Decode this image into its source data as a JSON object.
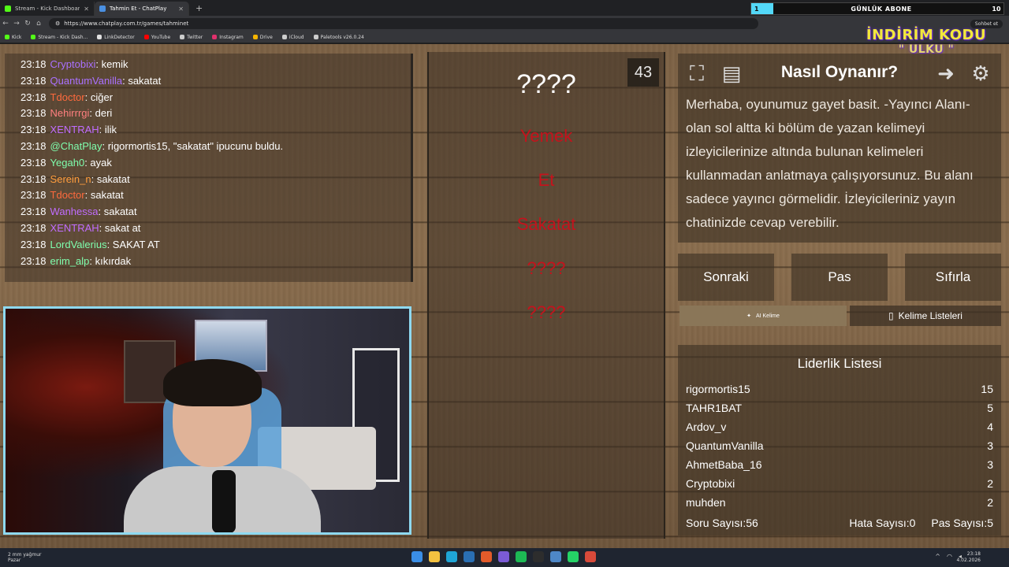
{
  "browser": {
    "tabs": [
      {
        "title": "Stream - Kick Dashboard",
        "favicon_color": "#53fc18",
        "active": false
      },
      {
        "title": "Tahmin Et - ChatPlay",
        "favicon_color": "#4a90e2",
        "active": true
      }
    ],
    "url": "https://www.chatplay.com.tr/games/tahminet",
    "chat_button": "Sohbet et",
    "bookmarks": [
      {
        "label": "Kick",
        "color": "#53fc18"
      },
      {
        "label": "Stream - Kick Dash...",
        "color": "#53fc18"
      },
      {
        "label": "LinkDetector",
        "color": "#e0e0e0"
      },
      {
        "label": "YouTube",
        "color": "#ff0000"
      },
      {
        "label": "Twitter",
        "color": "#cccccc"
      },
      {
        "label": "Instagram",
        "color": "#e1306c"
      },
      {
        "label": "Drive",
        "color": "#f4b400"
      },
      {
        "label": "iCloud",
        "color": "#cccccc"
      },
      {
        "label": "Paletools v26.0.24",
        "color": "#cccccc"
      }
    ]
  },
  "overlay": {
    "sub_goal_label": "GÜNLÜK ABONE",
    "sub_goal_current": "1",
    "sub_goal_target": "10",
    "sub_goal_fraction": 0.1,
    "promo_line1": "İNDİRİM KODU",
    "promo_line2": "\" ULKU \""
  },
  "chat": [
    {
      "time": "23:18",
      "user": "Cryptobixi",
      "color": "#a970ff",
      "text": ": kemik"
    },
    {
      "time": "23:18",
      "user": "QuantumVanilla",
      "color": "#a970ff",
      "text": ": sakatat"
    },
    {
      "time": "23:18",
      "user": "Tdoctor",
      "color": "#ff6a3d",
      "text": ": ciğer"
    },
    {
      "time": "23:18",
      "user": "Nehirrrgi",
      "color": "#ff7f7f",
      "text": ": deri"
    },
    {
      "time": "23:18",
      "user": "XENTRAH",
      "color": "#c06cff",
      "text": ": ilik"
    },
    {
      "time": "23:18",
      "user": "@ChatPlay",
      "color": "#7fffae",
      "text": ": rigormortis15, \"sakatat\" ipucunu buldu."
    },
    {
      "time": "23:18",
      "user": "Yegah0",
      "color": "#7fffae",
      "text": ": ayak"
    },
    {
      "time": "23:18",
      "user": "Serein_n",
      "color": "#ff9d3d",
      "text": ": sakatat"
    },
    {
      "time": "23:18",
      "user": "Tdoctor",
      "color": "#ff6a3d",
      "text": ": sakatat"
    },
    {
      "time": "23:18",
      "user": "Wanhessa",
      "color": "#c06cff",
      "text": ": sakatat"
    },
    {
      "time": "23:18",
      "user": "XENTRAH",
      "color": "#c06cff",
      "text": ": sakat at"
    },
    {
      "time": "23:18",
      "user": "LordValerius",
      "color": "#7fffae",
      "text": ": SAKAT AT"
    },
    {
      "time": "23:18",
      "user": "erim_alp",
      "color": "#7fffae",
      "text": ": kıkırdak"
    }
  ],
  "game": {
    "timer": "43",
    "main_word": "????",
    "clues": [
      "Yemek",
      "Et",
      "Sakatat",
      "????",
      "????"
    ]
  },
  "howto": {
    "title": "Nasıl Oynanır?",
    "text": "Merhaba, oyunumuz gayet basit. -Yayıncı Alanı- olan sol altta ki bölüm de yazan kelimeyi izleyicilerinize altında bulunan kelimeleri kullanmadan anlatmaya çalışıyorsunuz. Bu alanı sadece yayıncı görmelidir. İzleyicileriniz yayın chatinizde cevap verebilir."
  },
  "buttons": {
    "next": "Sonraki",
    "pass": "Pas",
    "reset": "Sıfırla",
    "ai_word": "AI Kelime",
    "word_lists": "Kelime Listeleri"
  },
  "leaderboard": {
    "title": "Liderlik Listesi",
    "rows": [
      {
        "name": "rigormortis15",
        "score": "15"
      },
      {
        "name": "TAHR1BAT",
        "score": "5"
      },
      {
        "name": "Ardov_v",
        "score": "4"
      },
      {
        "name": "QuantumVanilla",
        "score": "3"
      },
      {
        "name": "AhmetBaba_16",
        "score": "3"
      },
      {
        "name": "Cryptobixi",
        "score": "2"
      },
      {
        "name": "muhden",
        "score": "2"
      }
    ],
    "questions": "Soru Sayısı:56",
    "errors": "Hata Sayısı:0",
    "passes": "Pas Sayısı:5"
  },
  "taskbar": {
    "weather_line1": "2 mm yağmur",
    "weather_line2": "Pazar",
    "time": "23:18",
    "date": "4.02.2026"
  }
}
